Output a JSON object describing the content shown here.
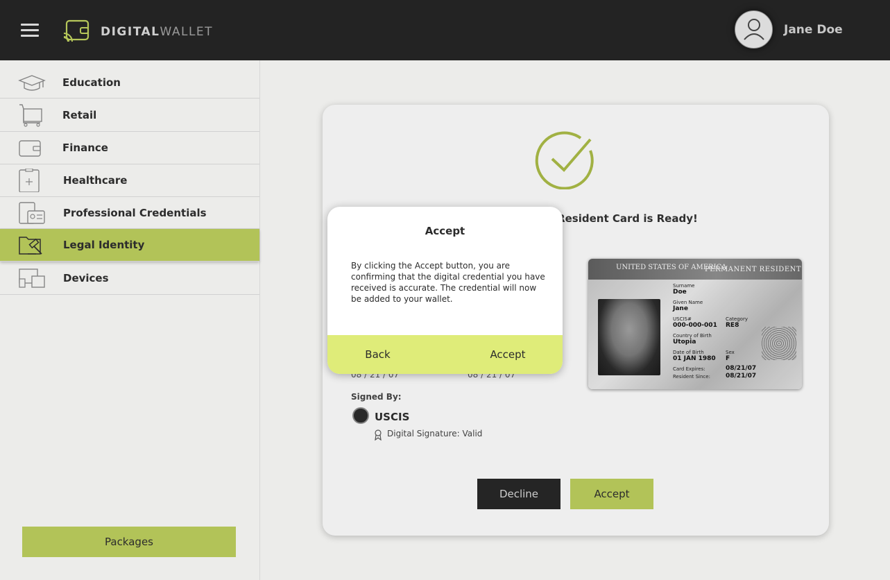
{
  "header": {
    "brand_bold": "DIGITAL",
    "brand_light": "WALLET",
    "user_name": "Jane Doe"
  },
  "sidebar": {
    "items": [
      {
        "label": "Education",
        "icon": "graduation-cap-icon"
      },
      {
        "label": "Retail",
        "icon": "shopping-cart-icon"
      },
      {
        "label": "Finance",
        "icon": "wallet-icon"
      },
      {
        "label": "Healthcare",
        "icon": "clipboard-plus-icon"
      },
      {
        "label": "Professional Credentials",
        "icon": "id-badge-icon"
      },
      {
        "label": "Legal Identity",
        "icon": "gavel-folder-icon"
      },
      {
        "label": "Devices",
        "icon": "devices-icon"
      }
    ],
    "active_item": "Legal Identity",
    "packages_label": "Packages"
  },
  "card": {
    "title_visible": "nt Resident Card is Ready!",
    "date_left": "08 / 21 / 07",
    "date_right": "08 / 21 / 07",
    "signed_by_label": "Signed By:",
    "issuer": "USCIS",
    "signature_status": "Digital Signature: Valid",
    "decline_label": "Decline",
    "accept_label": "Accept"
  },
  "id_card": {
    "country": "UNITED STATES OF AMERICA",
    "kind": "PERMANENT RESIDENT",
    "surname_label": "Surname",
    "surname": "Doe",
    "given_label": "Given Name",
    "given": "Jane",
    "uscis_label": "USCIS#",
    "uscis": "000-000-001",
    "category_label": "Category",
    "category": "RE8",
    "cob_label": "Country of Birth",
    "cob": "Utopia",
    "dob_label": "Date of Birth",
    "dob": "01 JAN 1980",
    "sex_label": "Sex",
    "sex": "F",
    "expires_label": "Card Expires:",
    "expires": "08/21/07",
    "since_label": "Resident Since:",
    "since": "08/21/07"
  },
  "modal": {
    "title": "Accept",
    "body": "By clicking the Accept button, you are confirming that the digital credential you have received is accurate. The credential will now be added to your wallet.",
    "back_label": "Back",
    "accept_label": "Accept"
  },
  "colors": {
    "accent": "#b6c75a",
    "modal_action_bar": "#dfec79",
    "header_bg": "#232323"
  }
}
